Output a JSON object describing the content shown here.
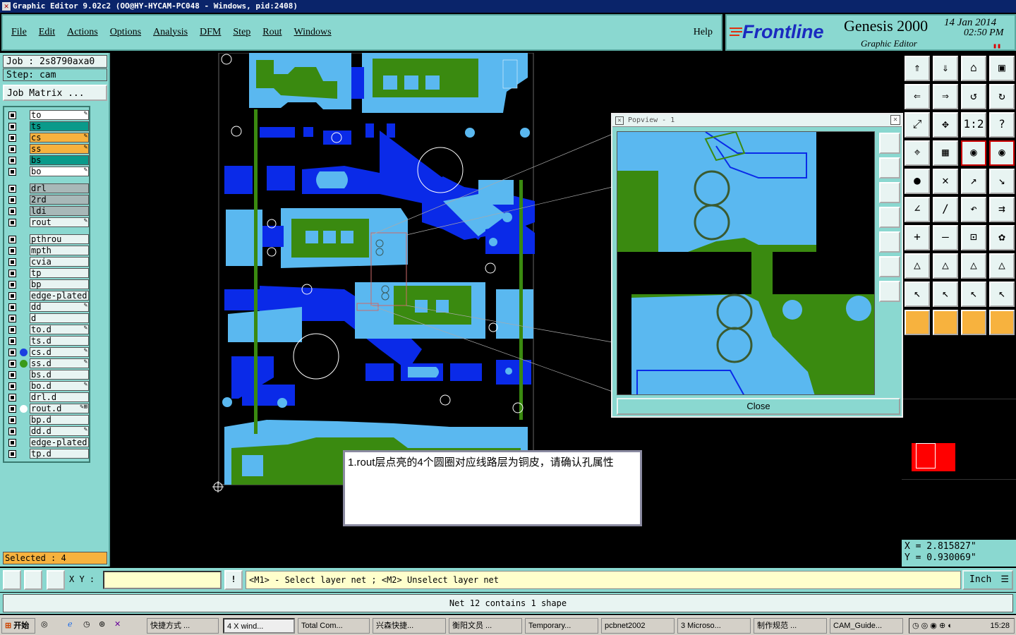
{
  "window": {
    "title": "Graphic Editor 9.02c2 (OO@HY-HYCAM-PC048 - Windows, pid:2408)"
  },
  "menu": {
    "items": [
      "File",
      "Edit",
      "Actions",
      "Options",
      "Analysis",
      "DFM",
      "Step",
      "Rout",
      "Windows"
    ],
    "help": "Help"
  },
  "brand": {
    "logo": "Frontline",
    "product": "Genesis 2000",
    "subtitle": "Graphic Editor",
    "date": "14 Jan 2014",
    "time": "02:50 PM"
  },
  "job": {
    "job_label": "Job : 2s8790axa0",
    "step_label": "Step: cam",
    "matrix_button": "Job Matrix ..."
  },
  "layers": [
    {
      "name": "to",
      "color": "#ffffff",
      "mark": "✎"
    },
    {
      "name": "ts",
      "color": "#0a9a8a",
      "mark": ""
    },
    {
      "name": "cs",
      "color": "#f7b23e",
      "mark": "✎"
    },
    {
      "name": "ss",
      "color": "#f7b23e",
      "mark": "✎"
    },
    {
      "name": "bs",
      "color": "#0a9a8a",
      "mark": ""
    },
    {
      "name": "bo",
      "color": "#ffffff",
      "mark": "✎"
    },
    {
      "name": "drl",
      "color": "#a8b8b8",
      "mark": ""
    },
    {
      "name": "2rd",
      "color": "#a8b8b8",
      "mark": ""
    },
    {
      "name": "ldi",
      "color": "#a8b8b8",
      "mark": ""
    },
    {
      "name": "rout",
      "color": "#e8f4f2",
      "mark": "✎"
    },
    {
      "name": "pthrou",
      "color": "#e8f4f2",
      "mark": ""
    },
    {
      "name": "mpth",
      "color": "#e8f4f2",
      "mark": ""
    },
    {
      "name": "cvia",
      "color": "#e8f4f2",
      "mark": ""
    },
    {
      "name": "tp",
      "color": "#e8f4f2",
      "mark": ""
    },
    {
      "name": "bp",
      "color": "#e8f4f2",
      "mark": ""
    },
    {
      "name": "edge-plated",
      "color": "#e8f4f2",
      "mark": ""
    },
    {
      "name": "dd",
      "color": "#e8f4f2",
      "mark": "✎"
    },
    {
      "name": "d",
      "color": "#e8f4f2",
      "mark": ""
    },
    {
      "name": "to.d",
      "color": "#e8f4f2",
      "mark": "✎"
    },
    {
      "name": "ts.d",
      "color": "#e8f4f2",
      "mark": ""
    },
    {
      "name": "cs.d",
      "color": "#e8f4f2",
      "mark": "✎",
      "dot": "#1a3fe0"
    },
    {
      "name": "ss.d",
      "color": "#e8f4f2",
      "mark": "✎",
      "dot": "#3a9a1a"
    },
    {
      "name": "bs.d",
      "color": "#e8f4f2",
      "mark": ""
    },
    {
      "name": "bo.d",
      "color": "#e8f4f2",
      "mark": "✎"
    },
    {
      "name": "drl.d",
      "color": "#e8f4f2",
      "mark": ""
    },
    {
      "name": "rout.d",
      "color": "#e8f4f2",
      "mark": "✎⊞",
      "dot": "#ffffff"
    },
    {
      "name": "bp.d",
      "color": "#e8f4f2",
      "mark": ""
    },
    {
      "name": "dd.d",
      "color": "#e8f4f2",
      "mark": "✎"
    },
    {
      "name": "edge-plated",
      "color": "#e8f4f2",
      "mark": ""
    },
    {
      "name": "tp.d",
      "color": "#e8f4f2",
      "mark": ""
    }
  ],
  "selected_label": "Selected : 4",
  "popview": {
    "title": "Popview - 1",
    "close_label": "Close"
  },
  "message": {
    "text": "1.rout层点亮的4个圆圈对应线路层为铜皮，请确认孔属性"
  },
  "coords": {
    "x": "X = 2.815827\"",
    "y": "Y = 0.930069\""
  },
  "bottom": {
    "xy_label": "X Y :",
    "xy_value": "",
    "prompt": "<M1> - Select layer net ; <M2> Unselect layer net",
    "unit": "Inch",
    "status": "Net 12 contains 1 shape"
  },
  "colors": {
    "copper": "#5ab8f0",
    "board": "#3a8a10",
    "pad": "#0a2ae8",
    "panel": "#8ad8d0",
    "highlight": "#f7b23e"
  },
  "taskbar": {
    "start": "开始",
    "tasks": [
      "快捷方式 ...",
      "4 X wind...",
      "Total Com...",
      "兴森快捷...",
      "衡阳文员 ...",
      "Temporary...",
      "pcbnet2002",
      "3 Microso...",
      "制作规范 ...",
      "CAM_Guide..."
    ],
    "clock": "15:28"
  }
}
